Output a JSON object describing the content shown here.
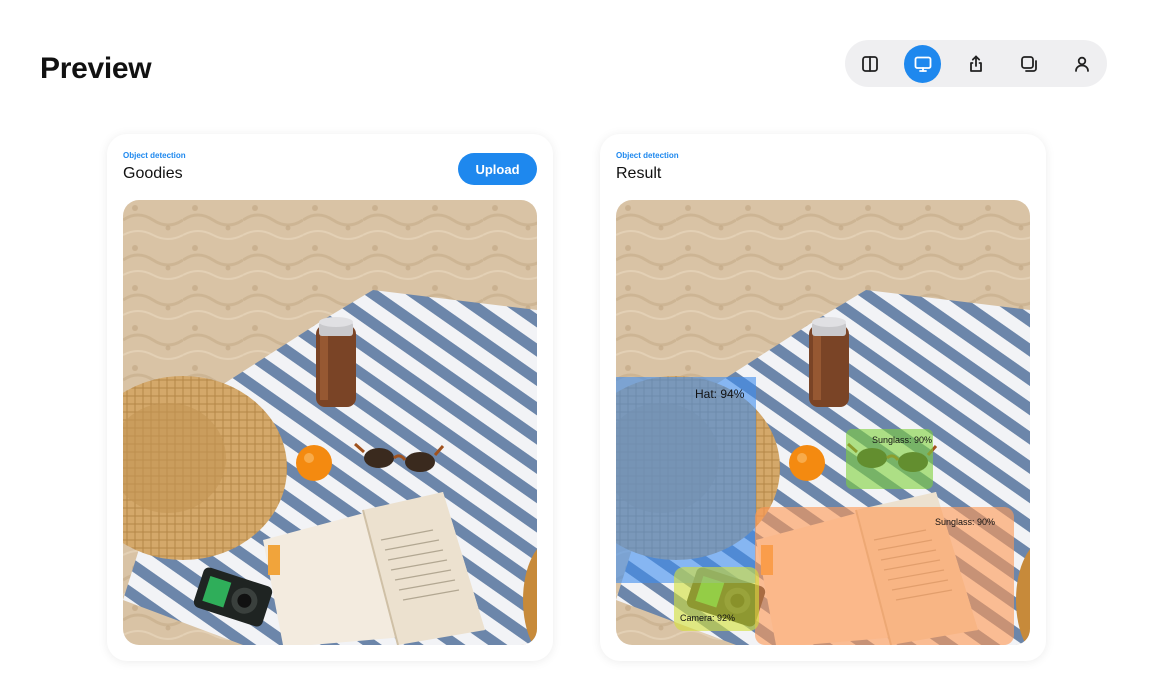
{
  "page": {
    "title": "Preview"
  },
  "toolbar": {
    "buttons": [
      {
        "name": "split-view-button",
        "icon": "split-view-icon",
        "active": false
      },
      {
        "name": "desktop-preview-button",
        "icon": "monitor-icon",
        "active": true
      },
      {
        "name": "share-button",
        "icon": "share-icon",
        "active": false
      },
      {
        "name": "duplicate-button",
        "icon": "duplicate-icon",
        "active": false
      },
      {
        "name": "profile-button",
        "icon": "user-icon",
        "active": false
      }
    ],
    "accent_color": "#1e88ee"
  },
  "input_card": {
    "overline": "Object detection",
    "title": "Goodies",
    "upload_label": "Upload"
  },
  "result_card": {
    "overline": "Object detection",
    "title": "Result",
    "detections": [
      {
        "label": "Hat: 94%",
        "color": "#3d8ef0"
      },
      {
        "label": "Sunglass: 90%",
        "color": "#7fd23a"
      },
      {
        "label": "Sunglass: 90%",
        "color": "#ff9a55"
      },
      {
        "label": "Camera: 92%",
        "color": "#d4e03a"
      }
    ]
  }
}
